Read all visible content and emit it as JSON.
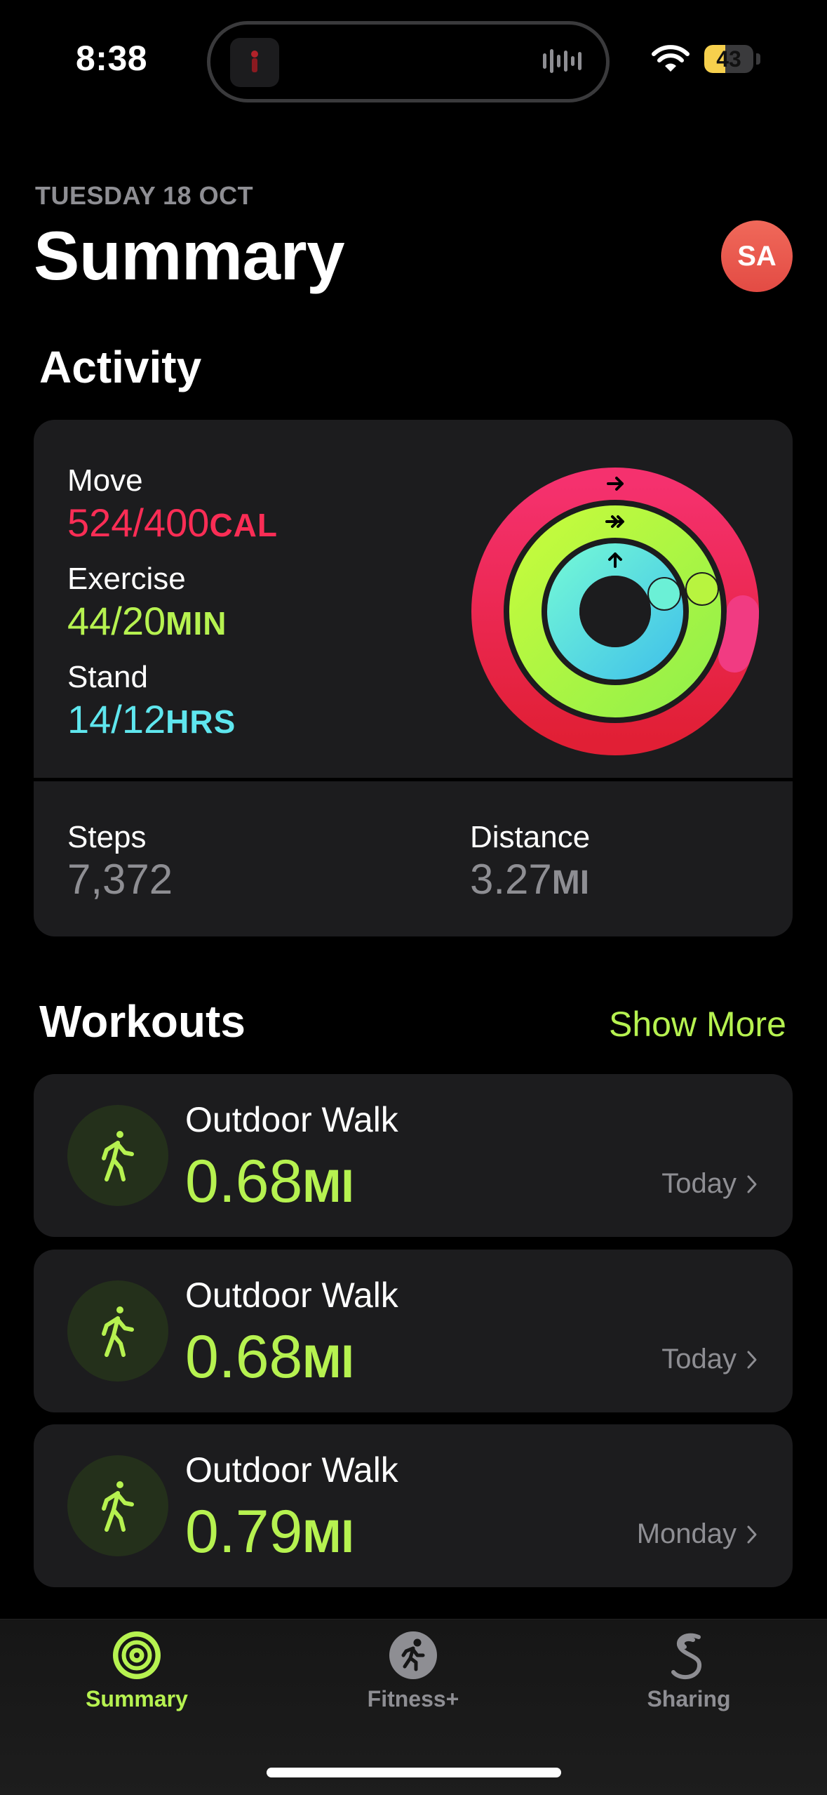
{
  "status": {
    "time": "8:38",
    "battery": "43",
    "battery_level": 0.43
  },
  "header": {
    "date": "TUESDAY 18 OCT",
    "title": "Summary",
    "avatar": "SA"
  },
  "activity": {
    "section_title": "Activity",
    "move": {
      "label": "Move",
      "value": "524/400",
      "unit": "CAL",
      "color": "#fa2d55"
    },
    "exercise": {
      "label": "Exercise",
      "value": "44/20",
      "unit": "MIN",
      "color": "#b6f250"
    },
    "stand": {
      "label": "Stand",
      "value": "14/12",
      "unit": "HRS",
      "color": "#5fe6ee"
    },
    "steps": {
      "label": "Steps",
      "value": "7,372"
    },
    "distance": {
      "label": "Distance",
      "value": "3.27",
      "unit": "MI"
    }
  },
  "workouts": {
    "section_title": "Workouts",
    "show_more": "Show More",
    "items": [
      {
        "name": "Outdoor Walk",
        "distance": "0.68",
        "unit": "MI",
        "date": "Today",
        "icon": "walking-figure-icon"
      },
      {
        "name": "Outdoor Walk",
        "distance": "0.68",
        "unit": "MI",
        "date": "Today",
        "icon": "walking-figure-icon"
      },
      {
        "name": "Outdoor Walk",
        "distance": "0.79",
        "unit": "MI",
        "date": "Monday",
        "icon": "walking-figure-icon"
      }
    ]
  },
  "tabs": [
    {
      "label": "Summary",
      "icon": "activity-rings-icon",
      "active": true
    },
    {
      "label": "Fitness+",
      "icon": "runner-icon",
      "active": false
    },
    {
      "label": "Sharing",
      "icon": "sharing-icon",
      "active": false
    }
  ],
  "colors": {
    "accent": "#b6f250",
    "card": "#1c1c1e",
    "muted": "#8e8e93"
  }
}
